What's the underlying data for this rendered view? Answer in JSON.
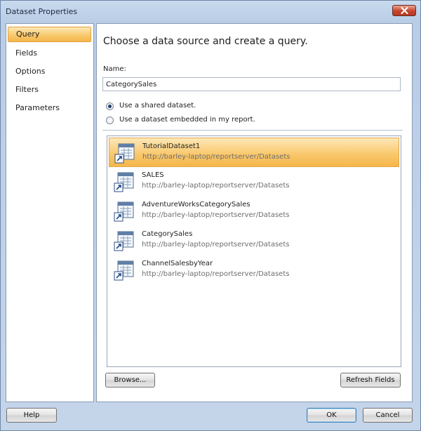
{
  "window": {
    "title": "Dataset Properties"
  },
  "nav": {
    "items": [
      {
        "label": "Query",
        "selected": true
      },
      {
        "label": "Fields",
        "selected": false
      },
      {
        "label": "Options",
        "selected": false
      },
      {
        "label": "Filters",
        "selected": false
      },
      {
        "label": "Parameters",
        "selected": false
      }
    ]
  },
  "main": {
    "heading": "Choose a data source and create a query.",
    "name_label": "Name:",
    "name_value": "CategorySales",
    "radios": [
      {
        "label": "Use a shared dataset.",
        "checked": true
      },
      {
        "label": "Use a dataset embedded in my report.",
        "checked": false
      }
    ],
    "datasets": [
      {
        "name": "TutorialDataset1",
        "path": "http://barley-laptop/reportserver/Datasets",
        "selected": true
      },
      {
        "name": "SALES",
        "path": "http://barley-laptop/reportserver/Datasets",
        "selected": false
      },
      {
        "name": "AdventureWorksCategorySales",
        "path": "http://barley-laptop/reportserver/Datasets",
        "selected": false
      },
      {
        "name": "CategorySales",
        "path": "http://barley-laptop/reportserver/Datasets",
        "selected": false
      },
      {
        "name": "ChannelSalesbyYear",
        "path": "http://barley-laptop/reportserver/Datasets",
        "selected": false
      }
    ],
    "browse_label": "Browse...",
    "refresh_label": "Refresh Fields"
  },
  "footer": {
    "help_label": "Help",
    "ok_label": "OK",
    "cancel_label": "Cancel"
  },
  "colors": {
    "selection": "#f9c96e",
    "window_bg": "#c4d5ea",
    "accent": "#3c7fb1"
  },
  "icons": {
    "close": "close-x-icon",
    "dataset": "shared-dataset-icon"
  }
}
